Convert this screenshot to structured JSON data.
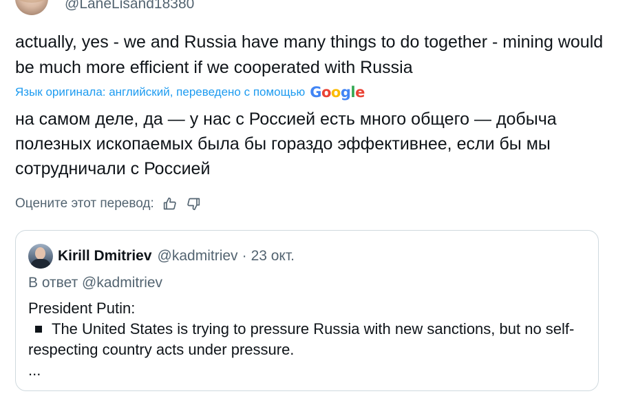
{
  "author": {
    "handle": "@LaneLisand18380"
  },
  "tweet": {
    "text": "actually, yes - we and Russia have many things to do together - mining would be much more efficient if we cooperated with Russia"
  },
  "translation": {
    "translated_by_label": "Язык оригинала: английский, переведено с помощью",
    "provider_logo": {
      "letters": [
        "G",
        "o",
        "o",
        "g",
        "l",
        "e"
      ],
      "colors": [
        "#4285f4",
        "#ea4335",
        "#fbbc05",
        "#4285f4",
        "#34a853",
        "#ea4335"
      ]
    },
    "text": "на самом деле, да — у нас с Россией есть много общего — добыча полезных ископаемых была бы гораздо эффективнее, если бы мы сотрудничали с Россией",
    "rate_label": "Оцените этот перевод:",
    "icons": [
      "thumbs-up-icon",
      "thumbs-down-icon"
    ]
  },
  "quote": {
    "name": "Kirill Dmitriev",
    "handle": "@kadmitriev",
    "separator": "·",
    "date": "23 окт.",
    "reply_prefix": "В ответ",
    "reply_handle": "@kadmitriev",
    "line1": "President Putin:",
    "bullet_text": "The United States is trying to pressure Russia with new sanctions, but no self-respecting country acts under pressure.",
    "ellipsis": "..."
  },
  "colors": {
    "link": "#1d9bf0",
    "secondary_text": "#536471",
    "primary_text": "#0f1419",
    "border": "#cfd9de"
  }
}
